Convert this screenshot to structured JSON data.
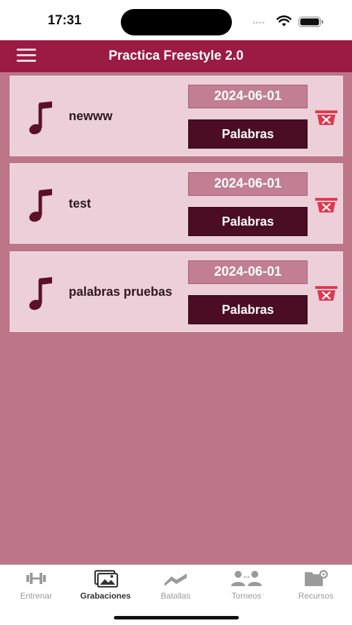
{
  "status_bar": {
    "time": "17:31"
  },
  "app_bar": {
    "title": "Practica Freestyle 2.0"
  },
  "recordings": [
    {
      "name": "newww",
      "date": "2024-06-01",
      "button": "Palabras"
    },
    {
      "name": "test",
      "date": "2024-06-01",
      "button": "Palabras"
    },
    {
      "name": "palabras pruebas",
      "date": "2024-06-01",
      "button": "Palabras"
    }
  ],
  "nav": {
    "items": [
      {
        "label": "Entrenar",
        "icon": "dumbbell-icon"
      },
      {
        "label": "Grabaciones",
        "icon": "photos-icon",
        "active": true
      },
      {
        "label": "Batallas",
        "icon": "trend-icon"
      },
      {
        "label": "Torneos",
        "icon": "people-icon"
      },
      {
        "label": "Recursos",
        "icon": "folder-gear-icon"
      }
    ]
  },
  "colors": {
    "app_bar": "#9b1b45",
    "content_bg": "#bd7589",
    "card_bg": "#eccfd8",
    "date_box": "#c27e92",
    "button": "#4b0d24",
    "delete": "#e0384e"
  }
}
